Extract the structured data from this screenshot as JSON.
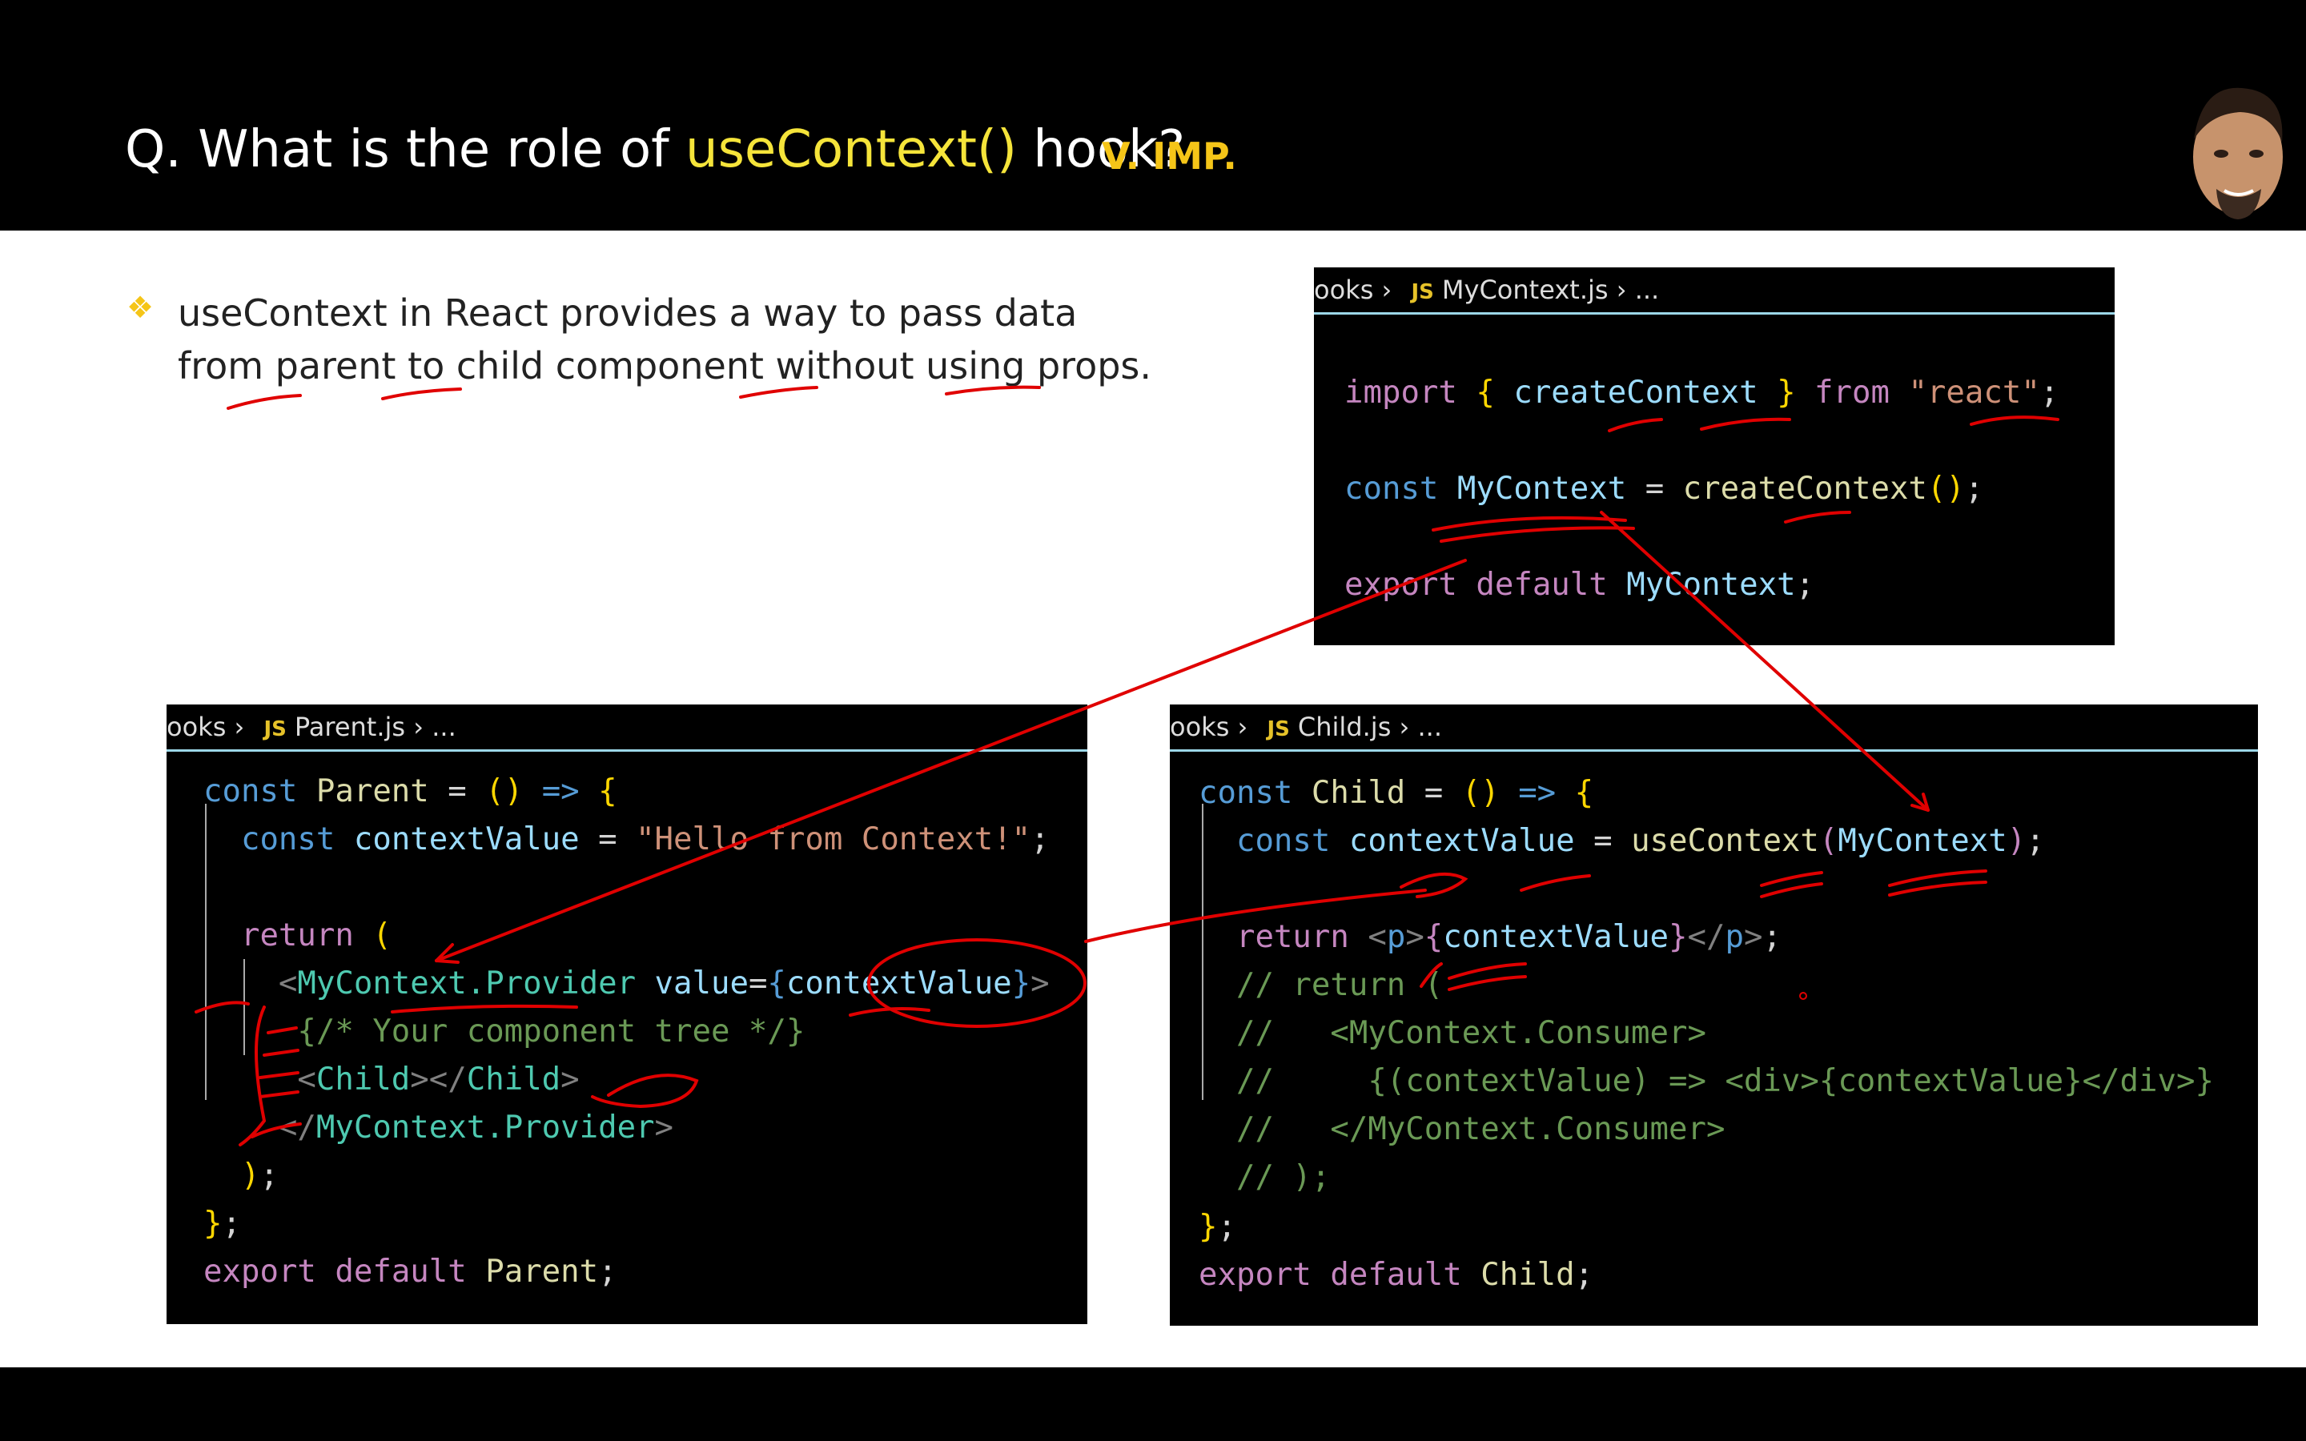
{
  "header": {
    "title_prefix": "Q. What is the role of ",
    "title_highlight": "useContext()",
    "title_suffix": " hook?",
    "importance_badge": "V. IMP."
  },
  "bullet": {
    "text": "useContext in React provides a way to pass data from parent to child component without using props."
  },
  "panels": {
    "context": {
      "breadcrumb_prefix": "ooks",
      "file_badge": "JS",
      "file_name": "MyContext.js",
      "ellipsis": "..."
    },
    "parent": {
      "breadcrumb_prefix": "ooks",
      "file_badge": "JS",
      "file_name": "Parent.js",
      "ellipsis": "..."
    },
    "child": {
      "breadcrumb_prefix": "ooks",
      "file_badge": "JS",
      "file_name": "Child.js",
      "ellipsis": "..."
    }
  },
  "code": {
    "context": {
      "import_kw": "import",
      "create_context": "createContext",
      "from_kw": "from",
      "module": "\"react\"",
      "const_kw": "const",
      "context_name": "MyContext",
      "create_call": "createContext",
      "export_kw": "export",
      "default_kw": "default"
    },
    "parent": {
      "const_kw": "const",
      "component": "Parent",
      "value_var": "contextValue",
      "value_string": "\"Hello from Context!\"",
      "return_kw": "return",
      "provider": "MyContext.Provider",
      "value_attr": "value",
      "tree_comment": "{/* Your component tree */}",
      "child_tag": "Child",
      "export_kw": "export",
      "default_kw": "default"
    },
    "child": {
      "const_kw": "const",
      "component": "Child",
      "value_var": "contextValue",
      "hook": "useContext",
      "hook_arg": "MyContext",
      "return_kw": "return",
      "p_tag": "p",
      "comment_1": "// return (",
      "comment_2": "//   <MyContext.Consumer>",
      "comment_3": "//     {(contextValue) => <div>{contextValue}</div>}",
      "comment_4": "//   </MyContext.Consumer>",
      "comment_5": "// );",
      "export_kw": "export",
      "default_kw": "default"
    }
  },
  "colors": {
    "accent": "#f5e43a",
    "badge": "#f5c518",
    "annotation": "#e00000"
  }
}
